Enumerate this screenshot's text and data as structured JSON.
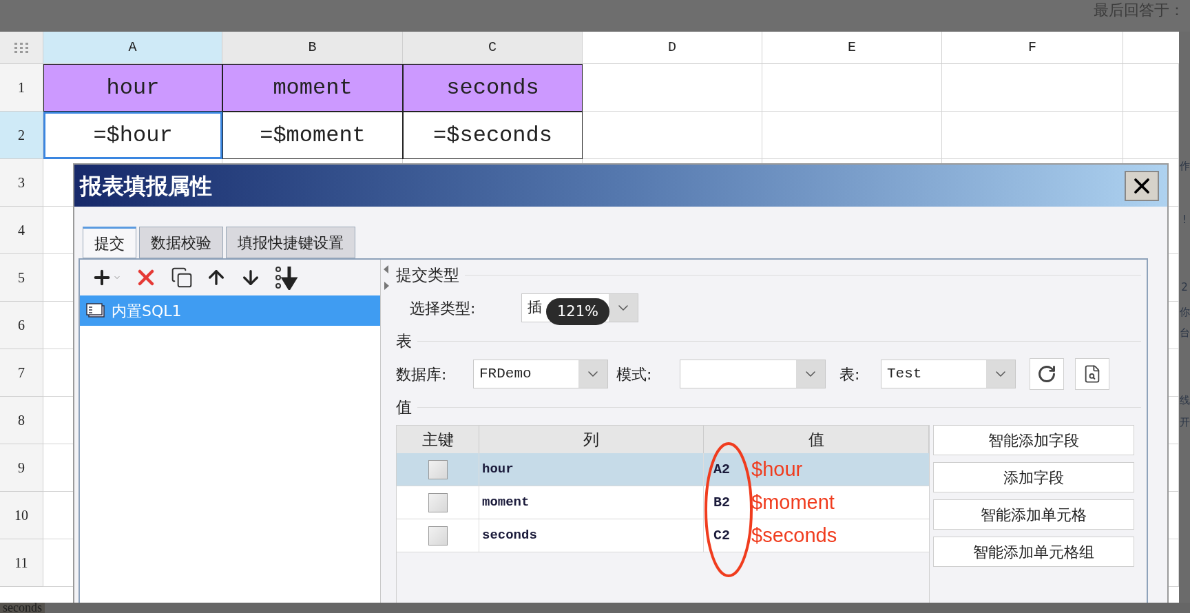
{
  "page_header": {
    "text": "最后回答于："
  },
  "side_text": [
    "作",
    "!",
    "2",
    "你",
    "台",
    "线",
    "开"
  ],
  "footer": {
    "text": "seconds"
  },
  "sheet": {
    "columns": [
      {
        "label": "A",
        "selected": true
      },
      {
        "label": "B",
        "selected": false
      },
      {
        "label": "C",
        "selected": false
      },
      {
        "label": "D",
        "selected": false
      },
      {
        "label": "E",
        "selected": false
      },
      {
        "label": "F",
        "selected": false
      }
    ],
    "rows": [
      {
        "label": "1",
        "selected": false,
        "cells": [
          {
            "text": "hour",
            "kind": "title",
            "selected": false
          },
          {
            "text": "moment",
            "kind": "title",
            "selected": false
          },
          {
            "text": "seconds",
            "kind": "title",
            "selected": false
          }
        ]
      },
      {
        "label": "2",
        "selected": true,
        "cells": [
          {
            "text": "=$hour",
            "kind": "formula",
            "selected": true
          },
          {
            "text": "=$moment",
            "kind": "formula",
            "selected": false
          },
          {
            "text": "=$seconds",
            "kind": "formula",
            "selected": false
          }
        ]
      },
      {
        "label": "3",
        "selected": false
      },
      {
        "label": "4",
        "selected": false
      },
      {
        "label": "5",
        "selected": false
      },
      {
        "label": "6",
        "selected": false
      },
      {
        "label": "7",
        "selected": false
      },
      {
        "label": "8",
        "selected": false
      },
      {
        "label": "9",
        "selected": false
      },
      {
        "label": "10",
        "selected": false
      },
      {
        "label": "11",
        "selected": false
      }
    ]
  },
  "dialog": {
    "title": "报表填报属性",
    "tabs": [
      {
        "label": "提交",
        "selected": true
      },
      {
        "label": "数据校验",
        "selected": false
      },
      {
        "label": "填报快捷键设置",
        "selected": false
      }
    ],
    "list": [
      {
        "label": "内置SQL1",
        "selected": true
      }
    ],
    "submit_type": {
      "group": "提交类型",
      "label": "选择类型:",
      "value": "插"
    },
    "table_group": "表",
    "database": {
      "label": "数据库:",
      "value": "FRDemo"
    },
    "schema": {
      "label": "模式:"
    },
    "table": {
      "label": "表:",
      "value": "Test"
    },
    "values_group": "值",
    "grid": {
      "columns": [
        "主键",
        "列",
        "值"
      ],
      "rows": [
        {
          "checked": false,
          "selected": true,
          "column": "hour",
          "value": "A2",
          "annotation": "$hour"
        },
        {
          "checked": false,
          "selected": false,
          "column": "moment",
          "value": "B2",
          "annotation": "$moment"
        },
        {
          "checked": false,
          "selected": false,
          "column": "seconds",
          "value": "C2",
          "annotation": "$seconds"
        }
      ]
    },
    "buttons": [
      "智能添加字段",
      "添加字段",
      "智能添加单元格",
      "智能添加单元格组"
    ]
  },
  "zoom_badge": "121%"
}
